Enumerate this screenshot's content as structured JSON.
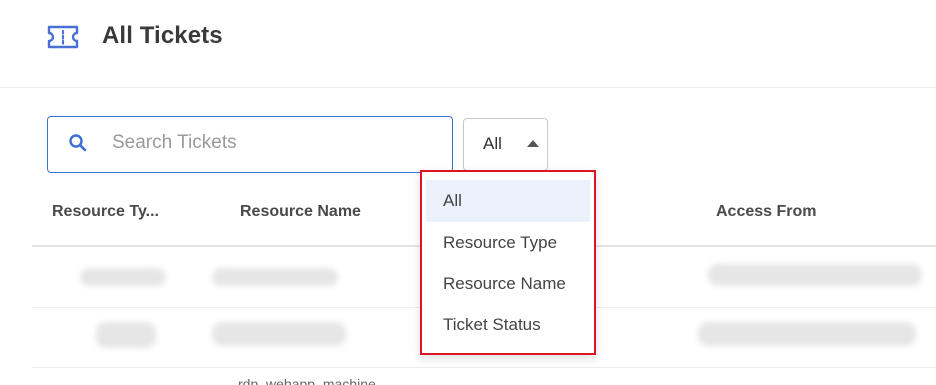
{
  "header": {
    "title": "All Tickets",
    "icon": "ticket-icon"
  },
  "search": {
    "placeholder": "Search Tickets",
    "value": ""
  },
  "filter": {
    "selected": "All",
    "options": [
      "All",
      "Resource Type",
      "Resource Name",
      "Ticket Status"
    ]
  },
  "table": {
    "columns": [
      "Resource Ty...",
      "Resource Name",
      "Access From"
    ],
    "partial_row_text": "rdp_webapp_machine"
  },
  "colors": {
    "accent": "#3f6fd8",
    "highlight_border": "#e0141e",
    "selected_bg": "#eaf1fb"
  }
}
